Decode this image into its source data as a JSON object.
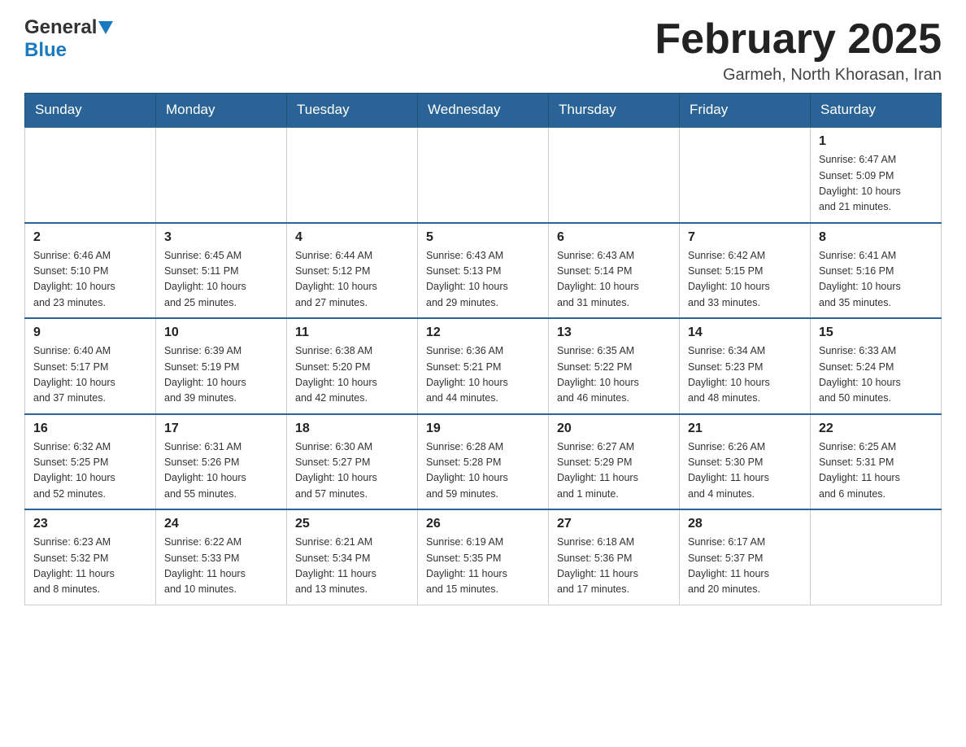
{
  "header": {
    "logo": {
      "general": "General",
      "blue": "Blue"
    },
    "title": "February 2025",
    "location": "Garmeh, North Khorasan, Iran"
  },
  "weekdays": [
    "Sunday",
    "Monday",
    "Tuesday",
    "Wednesday",
    "Thursday",
    "Friday",
    "Saturday"
  ],
  "weeks": [
    [
      {
        "day": "",
        "info": ""
      },
      {
        "day": "",
        "info": ""
      },
      {
        "day": "",
        "info": ""
      },
      {
        "day": "",
        "info": ""
      },
      {
        "day": "",
        "info": ""
      },
      {
        "day": "",
        "info": ""
      },
      {
        "day": "1",
        "info": "Sunrise: 6:47 AM\nSunset: 5:09 PM\nDaylight: 10 hours\nand 21 minutes."
      }
    ],
    [
      {
        "day": "2",
        "info": "Sunrise: 6:46 AM\nSunset: 5:10 PM\nDaylight: 10 hours\nand 23 minutes."
      },
      {
        "day": "3",
        "info": "Sunrise: 6:45 AM\nSunset: 5:11 PM\nDaylight: 10 hours\nand 25 minutes."
      },
      {
        "day": "4",
        "info": "Sunrise: 6:44 AM\nSunset: 5:12 PM\nDaylight: 10 hours\nand 27 minutes."
      },
      {
        "day": "5",
        "info": "Sunrise: 6:43 AM\nSunset: 5:13 PM\nDaylight: 10 hours\nand 29 minutes."
      },
      {
        "day": "6",
        "info": "Sunrise: 6:43 AM\nSunset: 5:14 PM\nDaylight: 10 hours\nand 31 minutes."
      },
      {
        "day": "7",
        "info": "Sunrise: 6:42 AM\nSunset: 5:15 PM\nDaylight: 10 hours\nand 33 minutes."
      },
      {
        "day": "8",
        "info": "Sunrise: 6:41 AM\nSunset: 5:16 PM\nDaylight: 10 hours\nand 35 minutes."
      }
    ],
    [
      {
        "day": "9",
        "info": "Sunrise: 6:40 AM\nSunset: 5:17 PM\nDaylight: 10 hours\nand 37 minutes."
      },
      {
        "day": "10",
        "info": "Sunrise: 6:39 AM\nSunset: 5:19 PM\nDaylight: 10 hours\nand 39 minutes."
      },
      {
        "day": "11",
        "info": "Sunrise: 6:38 AM\nSunset: 5:20 PM\nDaylight: 10 hours\nand 42 minutes."
      },
      {
        "day": "12",
        "info": "Sunrise: 6:36 AM\nSunset: 5:21 PM\nDaylight: 10 hours\nand 44 minutes."
      },
      {
        "day": "13",
        "info": "Sunrise: 6:35 AM\nSunset: 5:22 PM\nDaylight: 10 hours\nand 46 minutes."
      },
      {
        "day": "14",
        "info": "Sunrise: 6:34 AM\nSunset: 5:23 PM\nDaylight: 10 hours\nand 48 minutes."
      },
      {
        "day": "15",
        "info": "Sunrise: 6:33 AM\nSunset: 5:24 PM\nDaylight: 10 hours\nand 50 minutes."
      }
    ],
    [
      {
        "day": "16",
        "info": "Sunrise: 6:32 AM\nSunset: 5:25 PM\nDaylight: 10 hours\nand 52 minutes."
      },
      {
        "day": "17",
        "info": "Sunrise: 6:31 AM\nSunset: 5:26 PM\nDaylight: 10 hours\nand 55 minutes."
      },
      {
        "day": "18",
        "info": "Sunrise: 6:30 AM\nSunset: 5:27 PM\nDaylight: 10 hours\nand 57 minutes."
      },
      {
        "day": "19",
        "info": "Sunrise: 6:28 AM\nSunset: 5:28 PM\nDaylight: 10 hours\nand 59 minutes."
      },
      {
        "day": "20",
        "info": "Sunrise: 6:27 AM\nSunset: 5:29 PM\nDaylight: 11 hours\nand 1 minute."
      },
      {
        "day": "21",
        "info": "Sunrise: 6:26 AM\nSunset: 5:30 PM\nDaylight: 11 hours\nand 4 minutes."
      },
      {
        "day": "22",
        "info": "Sunrise: 6:25 AM\nSunset: 5:31 PM\nDaylight: 11 hours\nand 6 minutes."
      }
    ],
    [
      {
        "day": "23",
        "info": "Sunrise: 6:23 AM\nSunset: 5:32 PM\nDaylight: 11 hours\nand 8 minutes."
      },
      {
        "day": "24",
        "info": "Sunrise: 6:22 AM\nSunset: 5:33 PM\nDaylight: 11 hours\nand 10 minutes."
      },
      {
        "day": "25",
        "info": "Sunrise: 6:21 AM\nSunset: 5:34 PM\nDaylight: 11 hours\nand 13 minutes."
      },
      {
        "day": "26",
        "info": "Sunrise: 6:19 AM\nSunset: 5:35 PM\nDaylight: 11 hours\nand 15 minutes."
      },
      {
        "day": "27",
        "info": "Sunrise: 6:18 AM\nSunset: 5:36 PM\nDaylight: 11 hours\nand 17 minutes."
      },
      {
        "day": "28",
        "info": "Sunrise: 6:17 AM\nSunset: 5:37 PM\nDaylight: 11 hours\nand 20 minutes."
      },
      {
        "day": "",
        "info": ""
      }
    ]
  ]
}
